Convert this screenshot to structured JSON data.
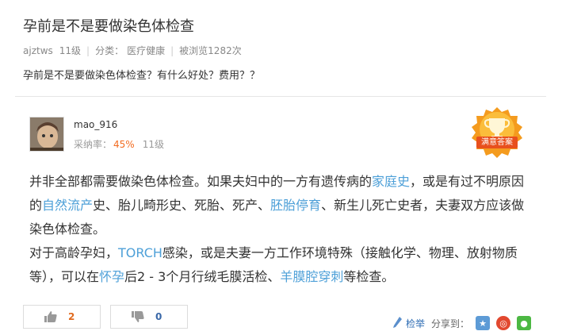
{
  "question": {
    "title": "孕前是不是要做染色体检查",
    "author": "ajztws",
    "level": "11级",
    "category_label": "分类：",
    "category": "医疗健康",
    "views": "被浏览1282次",
    "body": "孕前是不是要做染色体检查？有什么好处？费用？？"
  },
  "answer": {
    "username": "mao_916",
    "rate_label": "采纳率：",
    "rate_value": "45%",
    "level": "11级",
    "badge_text": "满意答案",
    "p1": [
      {
        "text": "并非全部都需要做染色体检查。如果夫妇中的一方有遗传病的"
      },
      {
        "text": "家庭史",
        "link": true
      },
      {
        "text": "，或是有过不明原因的"
      },
      {
        "text": "自然流产",
        "link": true
      },
      {
        "text": "史、胎儿畸形史、死胎、死产、"
      },
      {
        "text": "胚胎停育",
        "link": true
      },
      {
        "text": "、新生儿死亡史者，夫妻双方应该做染色体检查。"
      }
    ],
    "p2": [
      {
        "text": "对于高龄孕妇，"
      },
      {
        "text": "TORCH",
        "link": true
      },
      {
        "text": "感染，或是夫妻一方工作环境特殊（接触化学、物理、放射物质等），可以在"
      },
      {
        "text": "怀孕",
        "link": true
      },
      {
        "text": "后2 - 3个月行绒毛膜活检、"
      },
      {
        "text": "羊膜腔穿刺",
        "link": true
      },
      {
        "text": "等检查。"
      }
    ]
  },
  "actions": {
    "upvotes": "2",
    "downvotes": "0",
    "report_label": "检举",
    "share_label": "分享到：",
    "share_targets": [
      "qzone",
      "weibo",
      "wechat"
    ]
  },
  "colors": {
    "link": "#4ea0d8",
    "accent_orange": "#f26c21",
    "badge_orange": "#f49b1e"
  }
}
